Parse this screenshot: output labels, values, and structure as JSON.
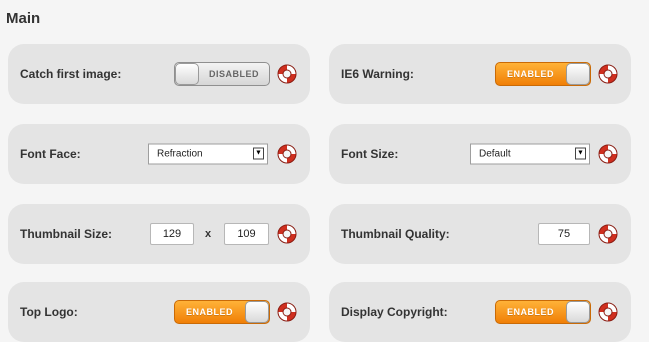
{
  "section": {
    "title": "Main"
  },
  "settings": {
    "catch_first_image": {
      "label": "Catch first image:",
      "toggle_text": "DISABLED",
      "enabled": false
    },
    "ie6_warning": {
      "label": "IE6 Warning:",
      "toggle_text": "ENABLED",
      "enabled": true
    },
    "font_face": {
      "label": "Font Face:",
      "value": "Refraction"
    },
    "font_size": {
      "label": "Font Size:",
      "value": "Default"
    },
    "thumbnail_size": {
      "label": "Thumbnail Size:",
      "width": "129",
      "separator": "x",
      "height": "109"
    },
    "thumbnail_quality": {
      "label": "Thumbnail Quality:",
      "value": "75"
    },
    "top_logo": {
      "label": "Top Logo:",
      "toggle_text": "ENABLED",
      "enabled": true
    },
    "display_copyright": {
      "label": "Display Copyright:",
      "toggle_text": "ENABLED",
      "enabled": true
    }
  },
  "icons": {
    "help": "lifebuoy-help-icon",
    "select_arrow": "dropdown-arrow-icon"
  },
  "colors": {
    "panel": "#e4e4e4",
    "toggle_on": "#f28a0f",
    "help_red": "#cf2f1f"
  }
}
